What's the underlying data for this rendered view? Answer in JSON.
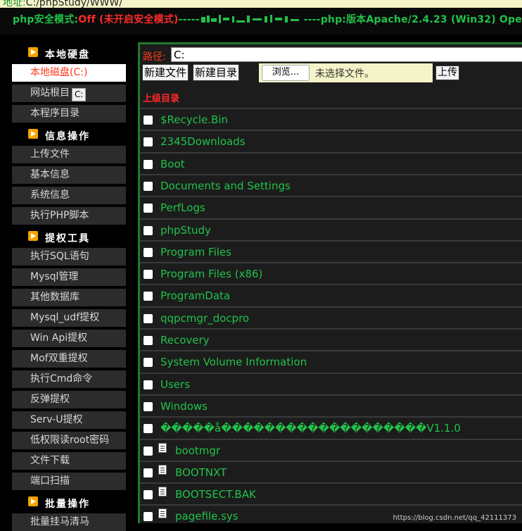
{
  "address": {
    "label": "地址:",
    "value": "C:/phpStudy/WWW/"
  },
  "header": {
    "safe_mode_label": "php安全模式:",
    "safe_mode_value": "Off (未开启安全模式)",
    "dashes1": "-----",
    "dashes2": "----",
    "version_text": "php:版本Apache/2.4.23 (Win32) Ope"
  },
  "sidebar": {
    "sections": [
      {
        "title": "本地硬盘",
        "items": [
          "本地磁盘(C:)",
          "网站根目",
          "本程序目录"
        ]
      },
      {
        "title": "信息操作",
        "items": [
          "上传文件",
          "基本信息",
          "系统信息",
          "执行PHP脚本"
        ]
      },
      {
        "title": "提权工具",
        "items": [
          "执行SQL语句",
          "Mysql管理",
          "其他数据库",
          "Mysql_udf提权",
          "Win Api提权",
          "Mof双重提权",
          "执行Cmd命令",
          "反弹提权",
          "Serv-U提权",
          "低权限读root密码",
          "文件下载",
          "端口扫描"
        ]
      },
      {
        "title": "批量操作",
        "items": [
          "批量挂马清马"
        ]
      }
    ],
    "tooltip": "C:"
  },
  "main": {
    "path_label": "路径:",
    "path_value": "C:",
    "new_file": "新建文件",
    "new_dir": "新建目录",
    "browse": "浏览...",
    "no_file": "未选择文件。",
    "upload": "上传",
    "parent_dir": "上级目录",
    "folders": [
      "$Recycle.Bin",
      "2345Downloads",
      "Boot",
      "Documents and Settings",
      "PerfLogs",
      "phpStudy",
      "Program Files",
      "Program Files (x86)",
      "ProgramData",
      "qqpcmgr_docpro",
      "Recovery",
      "System Volume Information",
      "Users",
      "Windows",
      "�����å�������������������V1.1.0"
    ],
    "files": [
      "bootmgr",
      "BOOTNXT",
      "BOOTSECT.BAK",
      "pagefile.sys"
    ]
  },
  "watermark": "https://blog.csdn.net/qq_42111373",
  "colors": {
    "green": "#21c24a",
    "red": "#ff2a2a",
    "accent": "#f6a300"
  }
}
